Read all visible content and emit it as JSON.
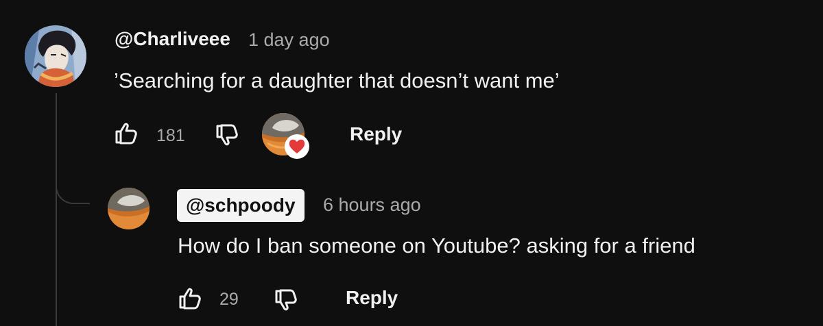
{
  "comment": {
    "author": "@Charliveee",
    "time": "1 day ago",
    "text": "’Searching for a daughter that doesn’t want me’",
    "likes": "181",
    "reply_label": "Reply",
    "icons": {
      "like": "thumbs-up-icon",
      "dislike": "thumbs-down-icon",
      "heart": "creator-heart-icon"
    }
  },
  "reply": {
    "author": "@schpoody",
    "time": "6 hours ago",
    "text": "How do I ban someone on Youtube? asking for a friend",
    "likes": "29",
    "reply_label": "Reply",
    "icons": {
      "like": "thumbs-up-icon",
      "dislike": "thumbs-down-icon"
    }
  },
  "colors": {
    "background": "#0f0f0f",
    "text": "#f1f1f1",
    "secondary_text": "#aaaaaa",
    "heart": "#e33a3a",
    "author_chip": "#f4f4f4"
  }
}
